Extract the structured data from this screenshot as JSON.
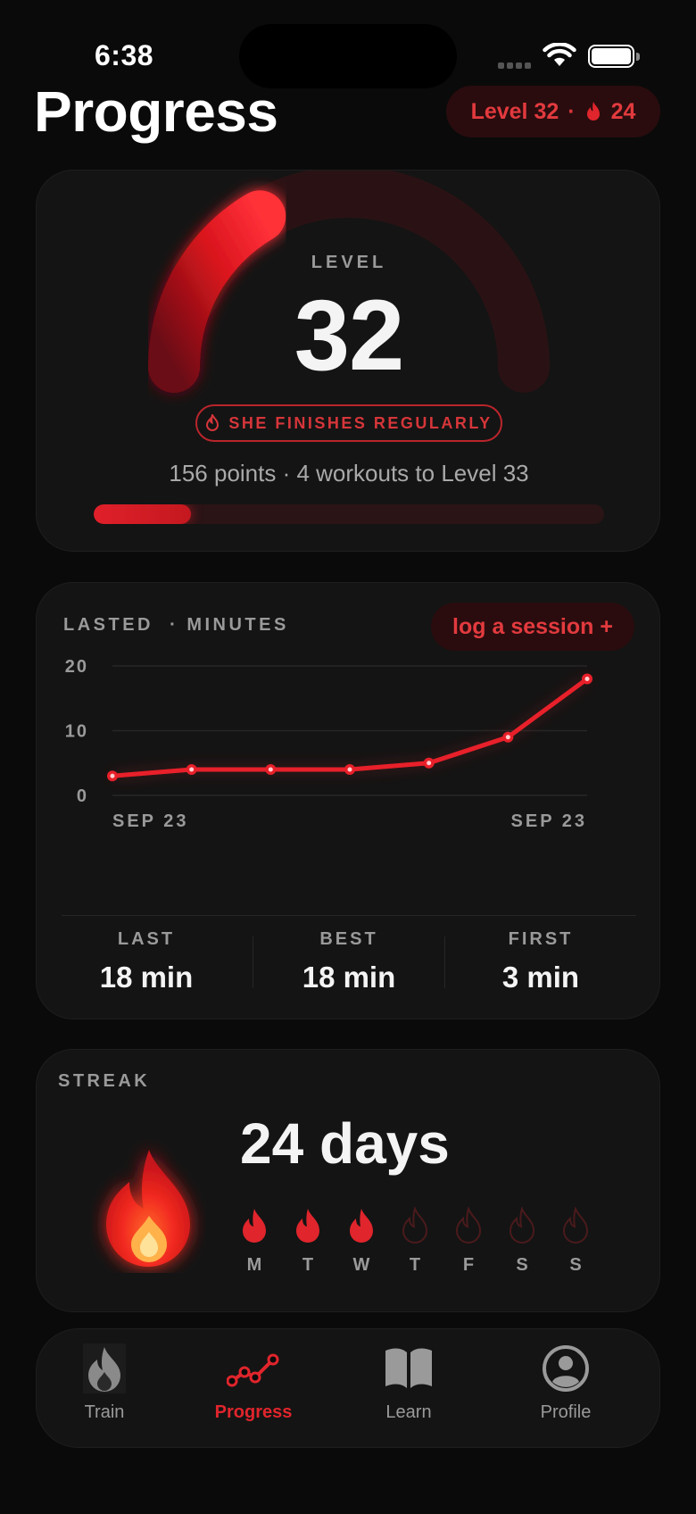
{
  "status_bar": {
    "time": "6:38"
  },
  "header": {
    "title": "Progress",
    "chip_level": "Level 32",
    "chip_separator": "·",
    "chip_streak": "24"
  },
  "level_card": {
    "label": "LEVEL",
    "value": "32",
    "badge": "SHE FINISHES REGULARLY",
    "points_text": "156 points · 4 workouts to Level 33",
    "progress_fraction": 0.19,
    "gauge_fraction": 0.33
  },
  "chart_card": {
    "title": "LASTED  · MINUTES",
    "action_label": "log a session +",
    "stats": [
      {
        "label": "LAST",
        "value": "18 min"
      },
      {
        "label": "BEST",
        "value": "18 min"
      },
      {
        "label": "FIRST",
        "value": "3 min"
      }
    ]
  },
  "chart_data": {
    "type": "line",
    "title": "LASTED · MINUTES",
    "xlabel": "",
    "ylabel": "",
    "x_tick_labels": [
      "SEP 23",
      "SEP 23"
    ],
    "y_ticks": [
      "0",
      "10",
      "20"
    ],
    "ylim": [
      0,
      20
    ],
    "grid": true,
    "series": [
      {
        "values": [
          3,
          4,
          4,
          4,
          5,
          9,
          18
        ],
        "color": "#e8202a"
      }
    ]
  },
  "streak_card": {
    "title": "STREAK",
    "value": "24 days",
    "days": [
      {
        "label": "M",
        "active": true
      },
      {
        "label": "T",
        "active": true
      },
      {
        "label": "W",
        "active": true
      },
      {
        "label": "T",
        "active": false
      },
      {
        "label": "F",
        "active": false
      },
      {
        "label": "S",
        "active": false
      },
      {
        "label": "S",
        "active": false
      }
    ]
  },
  "tabbar": {
    "items": [
      {
        "label": "Train",
        "icon": "flame-icon"
      },
      {
        "label": "Progress",
        "icon": "chart-line-icon",
        "active": true
      },
      {
        "label": "Learn",
        "icon": "book-icon"
      },
      {
        "label": "Profile",
        "icon": "person-circle-icon"
      }
    ]
  },
  "colors": {
    "accent": "#e8202a",
    "background": "#0a0a0a",
    "card": "#141414"
  }
}
